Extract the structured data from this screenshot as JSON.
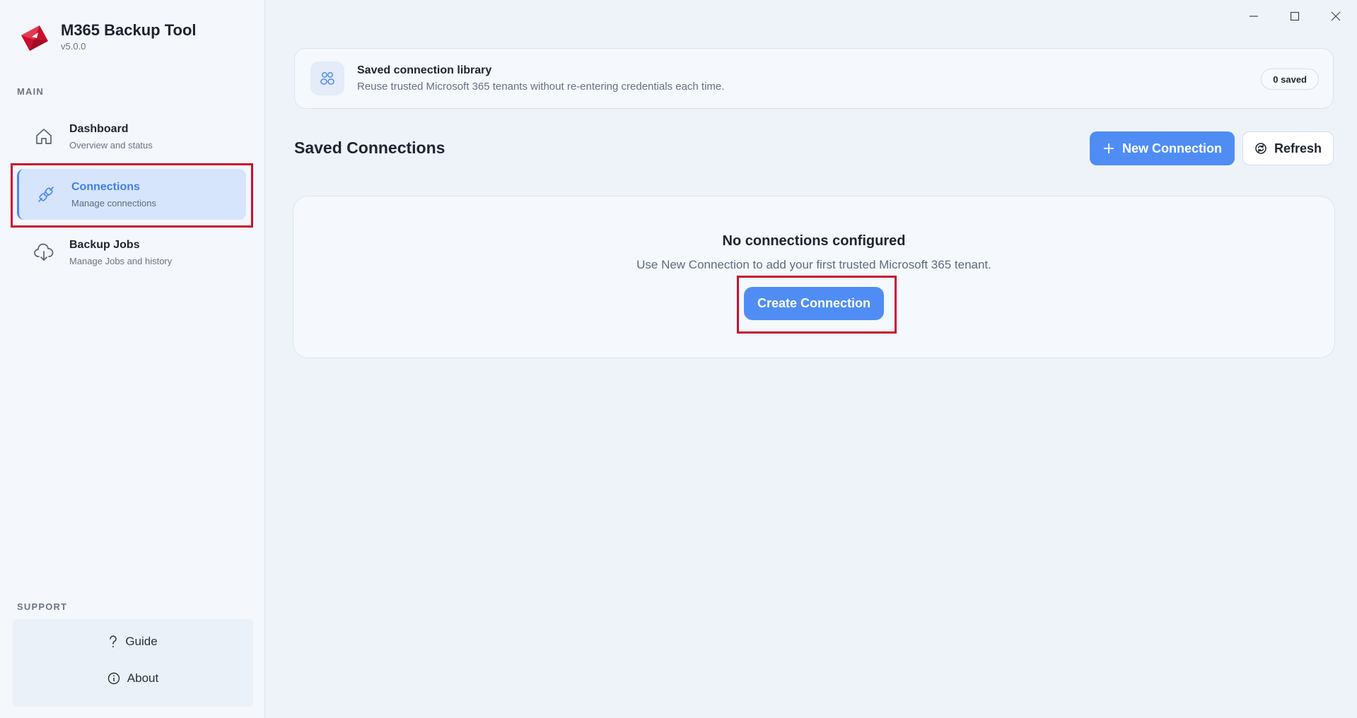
{
  "app": {
    "title": "M365 Backup Tool",
    "version": "v5.0.0",
    "logo_icon": "red-envelope-logo"
  },
  "sidebar": {
    "main_label": "MAIN",
    "items": [
      {
        "title": "Dashboard",
        "subtitle": "Overview and status",
        "icon": "home-icon",
        "active": false
      },
      {
        "title": "Connections",
        "subtitle": "Manage connections",
        "icon": "plug-icon",
        "active": true
      },
      {
        "title": "Backup Jobs",
        "subtitle": "Manage Jobs and history",
        "icon": "cloud-download-icon",
        "active": false
      }
    ],
    "support_label": "SUPPORT",
    "support_items": [
      {
        "label": "Guide",
        "icon": "question-icon"
      },
      {
        "label": "About",
        "icon": "info-icon"
      }
    ]
  },
  "banner": {
    "title": "Saved connection library",
    "subtitle": "Reuse trusted Microsoft 365 tenants without re-entering credentials each time.",
    "badge": "0 saved",
    "icon": "users-icon"
  },
  "main": {
    "title": "Saved Connections",
    "new_button": "New Connection",
    "refresh_button": "Refresh"
  },
  "empty_state": {
    "title": "No connections configured",
    "subtitle": "Use New Connection to add your first trusted Microsoft 365 tenant.",
    "button": "Create Connection"
  },
  "colors": {
    "accent": "#4f8df5",
    "highlight": "#c8102e",
    "active_nav_bg": "#d6e5fb"
  }
}
